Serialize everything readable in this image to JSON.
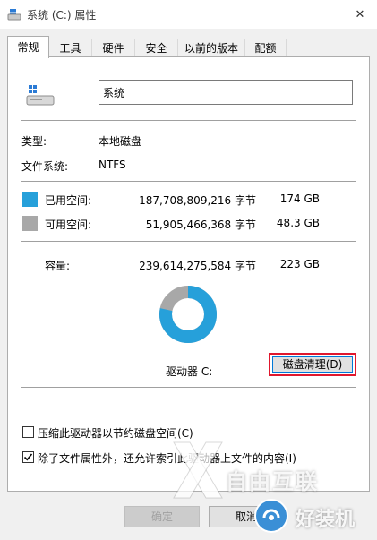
{
  "window": {
    "title": "系统 (C:) 属性",
    "close_label": "✕"
  },
  "tabs": [
    "常规",
    "工具",
    "硬件",
    "安全",
    "以前的版本",
    "配额"
  ],
  "general": {
    "name_value": "系统",
    "type_label": "类型:",
    "type_value": "本地磁盘",
    "fs_label": "文件系统:",
    "fs_value": "NTFS",
    "used_label": "已用空间:",
    "used_bytes": "187,708,809,216 字节",
    "used_size": "174 GB",
    "used_color": "#26a0da",
    "free_label": "可用空间:",
    "free_bytes": "51,905,466,368 字节",
    "free_size": "48.3 GB",
    "free_color": "#a8a8a8",
    "capacity_label": "容量:",
    "capacity_bytes": "239,614,275,584 字节",
    "capacity_size": "223 GB",
    "used_fraction": 0.7834,
    "drive_label": "驱动器 C:",
    "cleanup_button": "磁盘清理(D)",
    "compress_label": "压缩此驱动器以节约磁盘空间(C)",
    "compress_checked": false,
    "index_label": "除了文件属性外，还允许索引此驱动器上文件的内容(I)",
    "index_checked": true
  },
  "footer": {
    "ok": "确定",
    "cancel": "取消"
  },
  "watermark": {
    "line1": "自由互联",
    "line2": "好装机"
  }
}
